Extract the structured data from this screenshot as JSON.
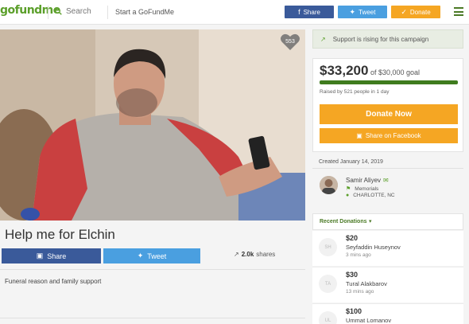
{
  "header": {
    "logo": "gofundme",
    "search_label": "Search",
    "start_label": "Start a GoFundMe",
    "share_label": "Share",
    "tweet_label": "Tweet",
    "donate_label": "Donate"
  },
  "campaign": {
    "title": "Help me for Elchin",
    "heart_count": "553",
    "share_label": "Share",
    "tweet_label": "Tweet",
    "shares_count": "2.0k",
    "shares_label": "shares",
    "story": "Funeral reason and family support"
  },
  "sidebar": {
    "rising_text": "Support is rising for this campaign",
    "raised_amount": "$33,200",
    "goal_text": "of $30,000 goal",
    "progress_fraction": 1.0,
    "raised_by": "Raised by 521 people in 1 day",
    "donate_now_label": "Donate Now",
    "share_facebook_label": "Share on Facebook",
    "created": "Created January 14, 2019",
    "organizer": {
      "name": "Samir Aliyev",
      "category": "Memorials",
      "location": "CHARLOTTE, NC"
    },
    "recent_label": "Recent Donations",
    "donations": [
      {
        "initials": "SH",
        "amount": "$20",
        "name": "Seyfaddin Huseynov",
        "time": "3 mins ago"
      },
      {
        "initials": "TA",
        "amount": "$30",
        "name": "Tural Alakbarov",
        "time": "13 mins ago"
      },
      {
        "initials": "UL",
        "amount": "$100",
        "name": "Ummat Lomanov",
        "time": ""
      }
    ]
  },
  "colors": {
    "brand_green": "#5b9f2a",
    "facebook_blue": "#3a5a9a",
    "twitter_blue": "#4a9fe0",
    "donate_orange": "#f5a623",
    "progress_green": "#3f7c1e"
  }
}
